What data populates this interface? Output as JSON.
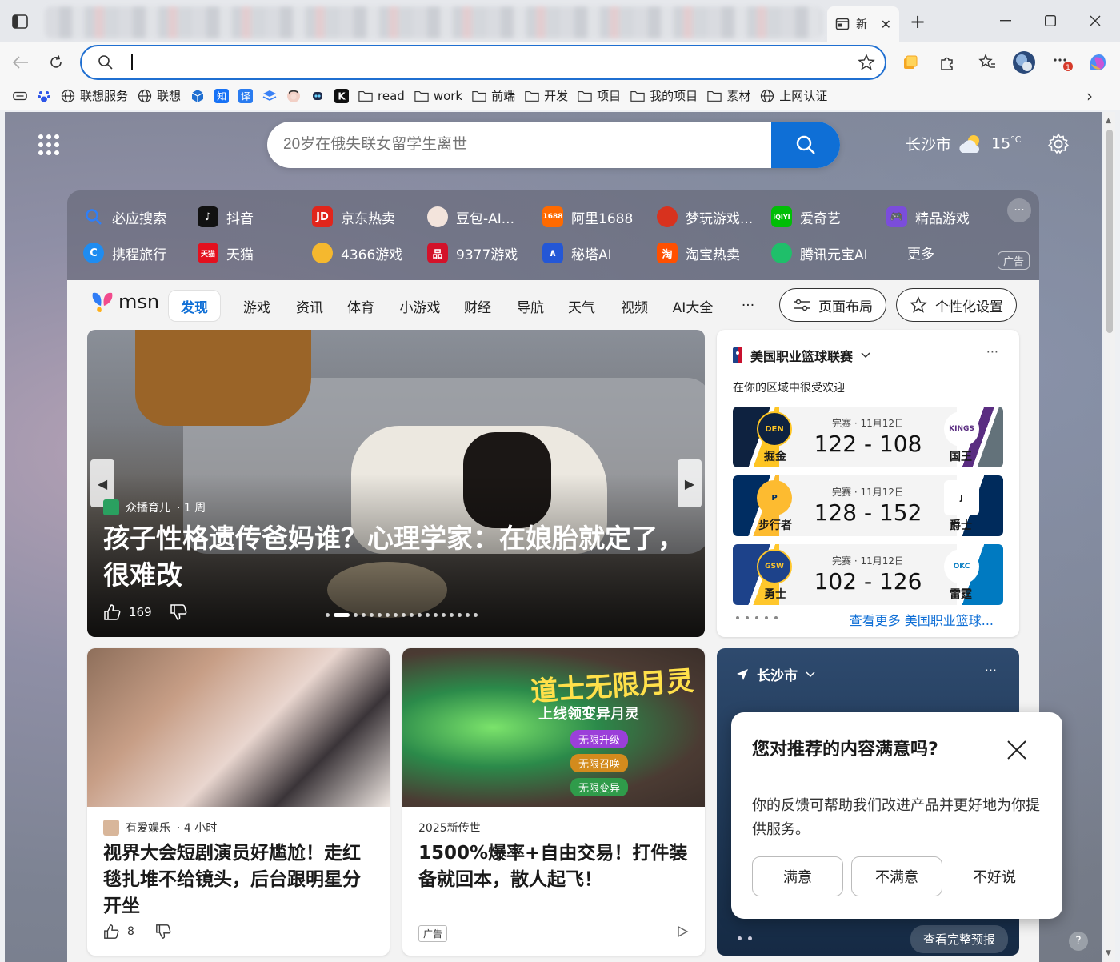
{
  "browser": {
    "active_tab_title": "新",
    "search_placeholder": "",
    "bookmarks": [
      {
        "label": "",
        "icon": "reading-list-icon"
      },
      {
        "label": "",
        "icon": "baidu-paw-icon"
      },
      {
        "label": "联想服务",
        "icon": "globe-icon"
      },
      {
        "label": "联想",
        "icon": "globe-icon"
      },
      {
        "label": "",
        "icon": "cube-icon"
      },
      {
        "label": "",
        "icon": "zhihu-icon"
      },
      {
        "label": "",
        "icon": "translate-icon"
      },
      {
        "label": "",
        "icon": "layers-icon"
      },
      {
        "label": "",
        "icon": "avatar-icon"
      },
      {
        "label": "",
        "icon": "robot-icon"
      },
      {
        "label": "",
        "icon": "k-logo-icon"
      },
      {
        "label": "read",
        "icon": "folder-icon"
      },
      {
        "label": "work",
        "icon": "folder-icon"
      },
      {
        "label": "前端",
        "icon": "folder-icon"
      },
      {
        "label": "开发",
        "icon": "folder-icon"
      },
      {
        "label": "项目",
        "icon": "folder-icon"
      },
      {
        "label": "我的项目",
        "icon": "folder-icon"
      },
      {
        "label": "素材",
        "icon": "folder-icon"
      },
      {
        "label": "上网认证",
        "icon": "globe-icon"
      }
    ]
  },
  "newtab": {
    "search_placeholder": "20岁在俄失联女留学生离世",
    "city": "长沙市",
    "temperature": "15",
    "temp_unit": "°C",
    "quicklinks_row1": [
      "必应搜索",
      "抖音",
      "京东热卖",
      "豆包-AI...",
      "阿里1688",
      "梦玩游戏...",
      "爱奇艺",
      "精品游戏"
    ],
    "quicklinks_row2": [
      "携程旅行",
      "天猫",
      "4366游戏",
      "9377游戏",
      "秘塔AI",
      "淘宝热卖",
      "腾讯元宝AI",
      "更多"
    ],
    "quicklinks_ad_label": "广告",
    "quicklinks_icons_row1": [
      "JD",
      "1688",
      "iQIYI"
    ],
    "quicklinks_icons_row2": [
      "天猫",
      "淘"
    ]
  },
  "feed": {
    "logo_text": "msn",
    "tabs": [
      "发现",
      "游戏",
      "资讯",
      "体育",
      "小游戏",
      "财经",
      "导航",
      "天气",
      "视频",
      "AI大全",
      "···"
    ],
    "layout_button": "页面布局",
    "personalize_button": "个性化设置",
    "hero": {
      "source": "众播育儿",
      "age": "· 1 周",
      "title": "孩子性格遗传爸妈谁？心理学家：在娘胎就定了，很难改",
      "likes": "169"
    },
    "nba": {
      "title": "美国职业篮球联赛",
      "subtitle": "在你的区域中很受欢迎",
      "see_more": "查看更多 美国职业篮球...",
      "games": [
        {
          "status": "完赛 · 11月12日",
          "score": "122 - 108",
          "home": "掘金",
          "away": "国王",
          "home_logo": "DEN",
          "away_logo": "KINGS"
        },
        {
          "status": "完赛 · 11月12日",
          "score": "128 - 152",
          "home": "步行者",
          "away": "爵士",
          "home_logo": "P",
          "away_logo": "J"
        },
        {
          "status": "完赛 · 11月12日",
          "score": "102 - 126",
          "home": "勇士",
          "away": "雷霆",
          "home_logo": "GSW",
          "away_logo": "OKC"
        }
      ]
    },
    "card1": {
      "source": "有爱娱乐",
      "age": "· 4 小时",
      "title": "视界大会短剧演员好尴尬！走红毯扎堆不给镜头，后台跟明星分开坐",
      "likes": "8"
    },
    "card2": {
      "source": "2025新传世",
      "title": "1500%爆率+自由交易！打件装备就回本，散人起飞！",
      "ad_label": "广告",
      "banner_title": "道士无限月灵",
      "banner_subtitle": "上线领变异月灵",
      "banner_tags": [
        "无限升级",
        "无限召唤",
        "无限变异"
      ]
    },
    "weather": {
      "city": "长沙市",
      "forecast_button": "查看完整预报"
    }
  },
  "feedback": {
    "question": "您对推荐的内容满意吗?",
    "description": "你的反馈可帮助我们改进产品并更好地为你提供服务。",
    "satisfied": "满意",
    "unsatisfied": "不满意",
    "not_sure": "不好说"
  },
  "help_label": "?",
  "colors": {
    "accent": "#0f6fd6",
    "nuggets": "#0e2240",
    "kings": "#5a2d81",
    "pacers": "#002d62",
    "jazz": "#002b5c",
    "warriors": "#1d428a",
    "thunder": "#007ac1"
  }
}
